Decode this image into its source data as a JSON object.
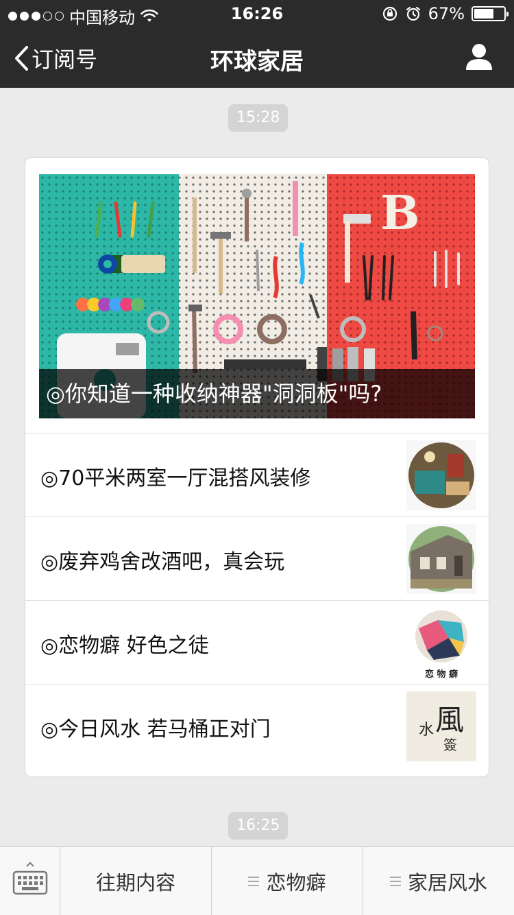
{
  "status_bar": {
    "carrier": "中国移动",
    "time": "16:26",
    "battery_text": "67%",
    "battery_level": 0.67,
    "signal_bars_filled": 3,
    "signal_bars_total": 5
  },
  "nav": {
    "back_label": "订阅号",
    "title": "环球家居"
  },
  "timestamps": {
    "first": "15:28",
    "second": "16:25"
  },
  "feed_card": {
    "cover": {
      "title": "◎你知道一种收纳神器\"洞洞板\"吗?",
      "banner_letter": "B"
    },
    "articles": [
      {
        "title": "◎70平米两室一厅混搭风装修",
        "thumb_icon": "living-room-photo"
      },
      {
        "title": "◎废弃鸡舍改酒吧，真会玩",
        "thumb_icon": "wooden-house-photo"
      },
      {
        "title": "◎恋物癖 好色之徒",
        "thumb_icon": "lianwupi-logo",
        "thumb_text": "恋 物 癖"
      },
      {
        "title": "◎今日风水 若马桶正对门",
        "thumb_icon": "fengshui-calligraphy",
        "thumb_text_main": "風",
        "thumb_text_side": "水",
        "thumb_text_sub": "簽"
      }
    ]
  },
  "bottom_bar": {
    "keyboard_icon": "keyboard-icon",
    "tabs": [
      {
        "label": "往期内容",
        "has_menu": false
      },
      {
        "label": "恋物癖",
        "has_menu": true
      },
      {
        "label": "家居风水",
        "has_menu": true
      }
    ]
  },
  "colors": {
    "nav_bg": "#2b2b2b",
    "page_bg": "#ebebeb",
    "pegboard_teal": "#2cb7a7",
    "pegboard_white": "#f1ece4",
    "pegboard_red": "#ef4944"
  }
}
